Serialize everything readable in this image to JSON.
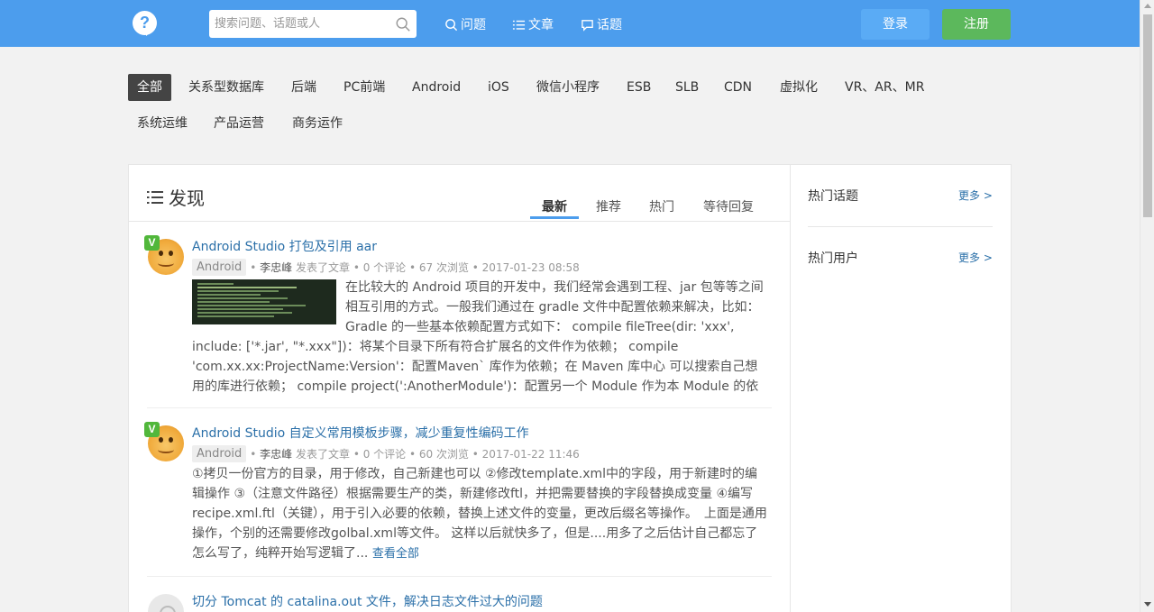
{
  "header": {
    "logo_glyph": "?",
    "search_placeholder": "搜索问题、话题或人",
    "nav": [
      {
        "label": "问题",
        "icon": "search-icon"
      },
      {
        "label": "文章",
        "icon": "list-icon"
      },
      {
        "label": "话题",
        "icon": "chat-icon"
      }
    ],
    "login_label": "登录",
    "register_label": "注册"
  },
  "categories": [
    "全部",
    "关系型数据库",
    "后端",
    "PC前端",
    "Android",
    "iOS",
    "微信小程序",
    "ESB",
    "SLB",
    "CDN",
    "虚拟化",
    "VR、AR、MR",
    "系统运维",
    "产品运营",
    "商务运作"
  ],
  "discover": {
    "title": "发现",
    "tabs": [
      "最新",
      "推荐",
      "热门",
      "等待回复"
    ]
  },
  "items": [
    {
      "title": "Android Studio 打包及引用 aar",
      "tag": "Android",
      "author": "李忠峰",
      "meta": "发表了文章 • 0 个评论 • 67 次浏览 • 2017-01-23 08:58",
      "excerpt": "在比较大的 Android 项目的开发中，我们经常会遇到工程、jar 包等等之间相互引用的方式。一般我们通过在 gradle 文件中配置依赖来解决，比如： Gradle 的一些基本依赖配置方式如下： compile fileTree(dir: 'xxx', include: ['*.jar', \"*.xxx\"])：将某个目录下所有符合扩展名的文件作为依赖； compile 'com.xx.xx:ProjectName:Version'：配置Maven` 库作为依赖；在 Maven 库中心 可以搜索自己想用的库进行依赖； compile project(':AnotherModule')：配置另一个 Module 作为本 Module 的依赖，被"
    },
    {
      "title": "Android Studio 自定义常用模板步骤，减少重复性编码工作",
      "tag": "Android",
      "author": "李忠峰",
      "meta": "发表了文章 • 0 个评论 • 60 次浏览 • 2017-01-22 11:46",
      "excerpt": "①拷贝一份官方的目录，用于修改，自己新建也可以 ②修改template.xml中的字段，用于新建时的编辑操作 ③（注意文件路径）根据需要生产的类，新建修改ftl，并把需要替换的字段替换成变量 ④编写recipe.xml.ftl（关键），用于引入必要的依赖，替换上述文件的变量，更改后缀名等操作。　上面是通用操作，个别的还需要修改golbal.xml等文件。 这样以后就快多了，但是....用多了之后估计自己都忘了怎么写了，纯粹开始写逻辑了...",
      "see_all": "查看全部"
    },
    {
      "title": "切分 Tomcat 的 catalina.out 文件，解决日志文件过大的问题"
    }
  ],
  "sidebar": {
    "hot_topics": "热门话题",
    "hot_users": "热门用户",
    "more": "更多 >"
  },
  "colors": {
    "topbar": "#4c9ded",
    "register": "#5cb85c",
    "link": "#2a6fa8"
  }
}
